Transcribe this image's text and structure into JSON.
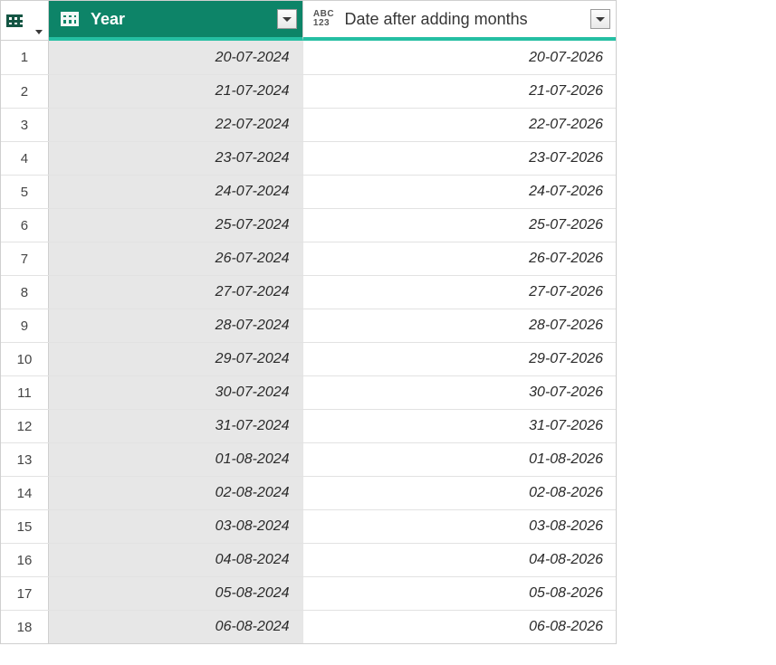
{
  "columns": {
    "year": {
      "label": "Year"
    },
    "date": {
      "label": "Date after adding months",
      "typeIcon": {
        "line1": "ABC",
        "line2": "123"
      }
    }
  },
  "rows": [
    {
      "n": "1",
      "year": "20-07-2024",
      "date": "20-07-2026"
    },
    {
      "n": "2",
      "year": "21-07-2024",
      "date": "21-07-2026"
    },
    {
      "n": "3",
      "year": "22-07-2024",
      "date": "22-07-2026"
    },
    {
      "n": "4",
      "year": "23-07-2024",
      "date": "23-07-2026"
    },
    {
      "n": "5",
      "year": "24-07-2024",
      "date": "24-07-2026"
    },
    {
      "n": "6",
      "year": "25-07-2024",
      "date": "25-07-2026"
    },
    {
      "n": "7",
      "year": "26-07-2024",
      "date": "26-07-2026"
    },
    {
      "n": "8",
      "year": "27-07-2024",
      "date": "27-07-2026"
    },
    {
      "n": "9",
      "year": "28-07-2024",
      "date": "28-07-2026"
    },
    {
      "n": "10",
      "year": "29-07-2024",
      "date": "29-07-2026"
    },
    {
      "n": "11",
      "year": "30-07-2024",
      "date": "30-07-2026"
    },
    {
      "n": "12",
      "year": "31-07-2024",
      "date": "31-07-2026"
    },
    {
      "n": "13",
      "year": "01-08-2024",
      "date": "01-08-2026"
    },
    {
      "n": "14",
      "year": "02-08-2024",
      "date": "02-08-2026"
    },
    {
      "n": "15",
      "year": "03-08-2024",
      "date": "03-08-2026"
    },
    {
      "n": "16",
      "year": "04-08-2024",
      "date": "04-08-2026"
    },
    {
      "n": "17",
      "year": "05-08-2024",
      "date": "05-08-2026"
    },
    {
      "n": "18",
      "year": "06-08-2024",
      "date": "06-08-2026"
    }
  ]
}
